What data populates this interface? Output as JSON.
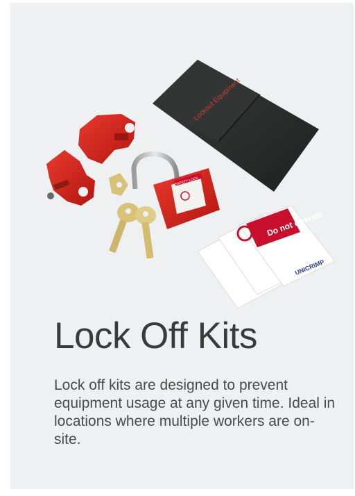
{
  "product": {
    "title": "Lock Off Kits",
    "description": "Lock off kits are designed to prevent equipment usage at any given time. Ideal in locations where multiple workers are on-site.",
    "pouch_label": "Lockout Equipment",
    "padlock_label": "SAFETY LOCK",
    "tag_text": "Do not operate",
    "tag_brand": "UNICRIMP"
  },
  "colors": {
    "card_background": "#eef0f2",
    "lockout_red": "#d91f1f",
    "pouch_black": "#2a2b2b",
    "brass": "#d8c27a",
    "tag_red": "#c8102e"
  }
}
